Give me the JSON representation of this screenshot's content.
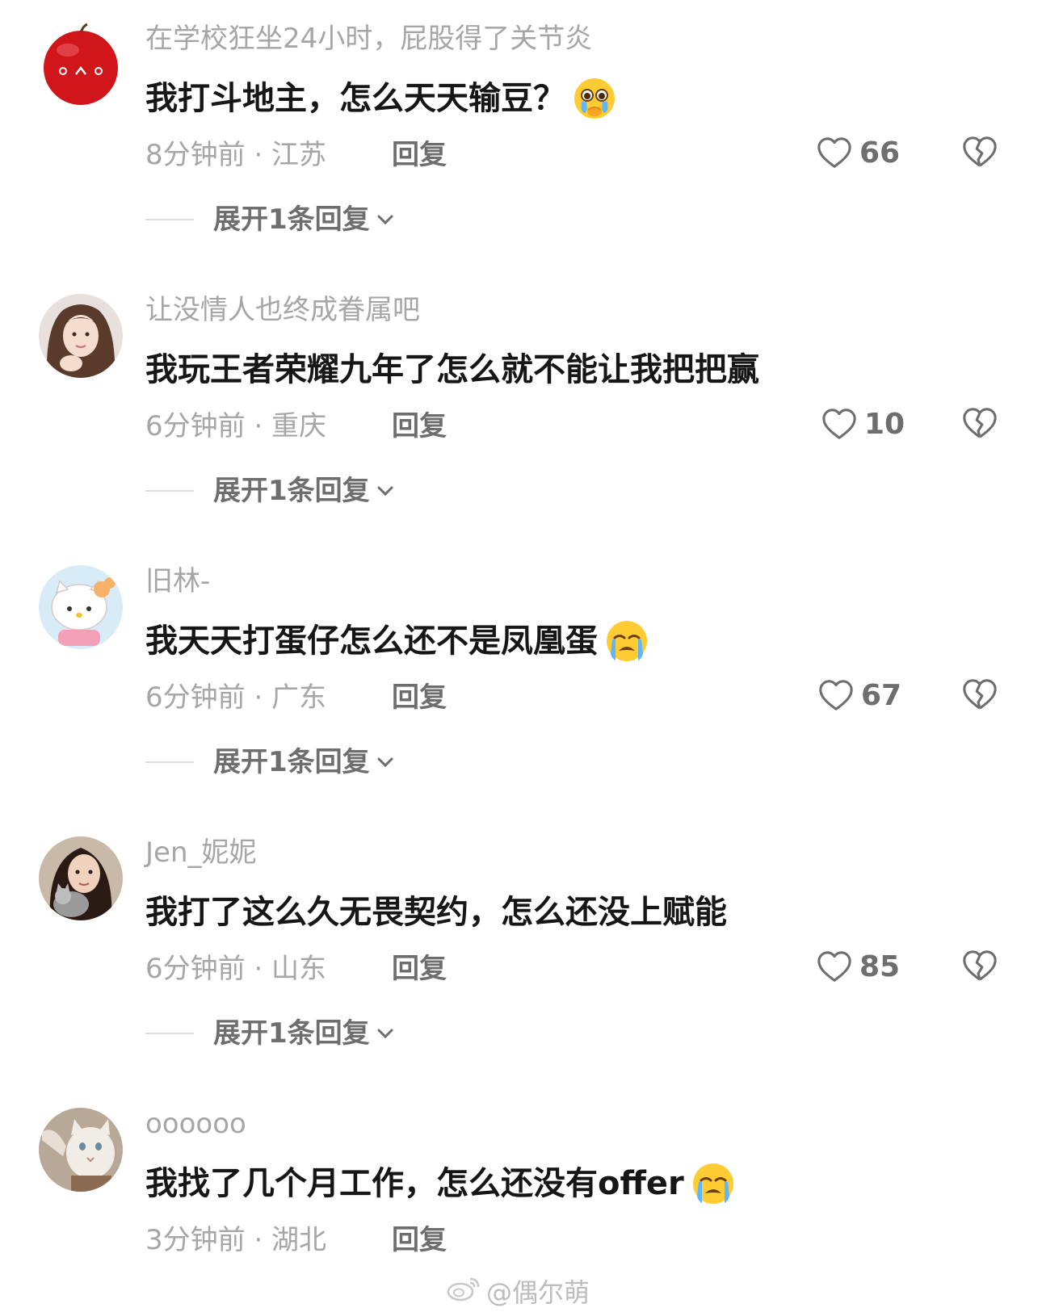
{
  "comments": [
    {
      "username": "在学校狂坐24小时，屁股得了关节炎",
      "text": "我打斗地主，怎么天天输豆？",
      "emoji": "pleading-face-crying",
      "meta": "8分钟前 · 江苏",
      "reply_label": "回复",
      "likes": "66",
      "expand_label": "展开1条回复",
      "avatar": "apple-face"
    },
    {
      "username": "让没情人也终成眷属吧",
      "text": "我玩王者荣耀九年了怎么就不能让我把把赢",
      "emoji": "",
      "meta": "6分钟前 · 重庆",
      "reply_label": "回复",
      "likes": "10",
      "expand_label": "展开1条回复",
      "avatar": "girl-photo"
    },
    {
      "username": "旧林-",
      "text": "我天天打蛋仔怎么还不是凤凰蛋",
      "emoji": "loudly-crying-face",
      "meta": "6分钟前 · 广东",
      "reply_label": "回复",
      "likes": "67",
      "expand_label": "展开1条回复",
      "avatar": "hello-kitty"
    },
    {
      "username": "Jen_妮妮",
      "text": "我打了这么久无畏契约，怎么还没上赋能",
      "emoji": "",
      "meta": "6分钟前 · 山东",
      "reply_label": "回复",
      "likes": "85",
      "expand_label": "展开1条回复",
      "avatar": "girl-with-cat"
    },
    {
      "username": "oooooo",
      "text": "我找了几个月工作，怎么还没有offer",
      "emoji": "loudly-crying-face",
      "meta": "3分钟前 · 湖北",
      "reply_label": "回复",
      "likes": "",
      "expand_label": "",
      "avatar": "cat-photo"
    }
  ],
  "watermark": "@偶尔萌",
  "icons": {
    "like": "heart-outline-icon",
    "dislike": "broken-heart-icon",
    "expand": "chevron-down-icon",
    "watermark": "weibo-logo-icon"
  },
  "colors": {
    "text_primary": "#161616",
    "text_secondary": "#a6a6a6",
    "text_action": "#6e6e6e"
  }
}
